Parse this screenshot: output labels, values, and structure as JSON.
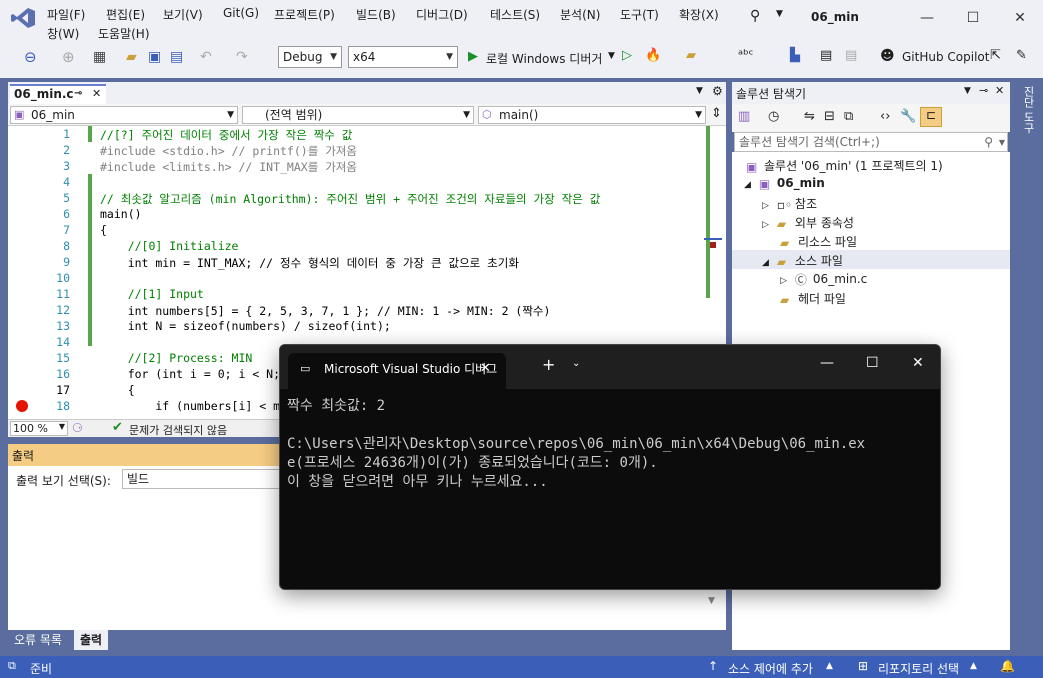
{
  "window": {
    "title": "06_min"
  },
  "menu": [
    "파일(F)",
    "편집(E)",
    "보기(V)",
    "Git(G)",
    "프로젝트(P)",
    "빌드(B)",
    "디버그(D)",
    "테스트(S)",
    "분석(N)",
    "도구(T)",
    "확장(X)",
    "창(W)",
    "도움말(H)"
  ],
  "toolbar": {
    "config": "Debug",
    "platform": "x64",
    "run_label": "로컬 Windows 디버거",
    "copilot": "GitHub Copilot"
  },
  "editor": {
    "tab": "06_min.c",
    "nav_project": "06_min",
    "nav_scope": "(전역 범위)",
    "nav_func": "main()",
    "zoom": "100 %",
    "status": "문제가 검색되지 않음",
    "lines": [
      {
        "n": "1",
        "text": "//[?] 주어진 데이터 중에서 가장 작은 짝수 값"
      },
      {
        "n": "2",
        "text": "#include <stdio.h> // printf()를 가져옴"
      },
      {
        "n": "3",
        "text": "#include <limits.h> // INT_MAX를 가져옴"
      },
      {
        "n": "4",
        "text": ""
      },
      {
        "n": "5",
        "text": "// 최솟값 알고리즘 (min Algorithm): 주어진 범위 + 주어진 조건의 자료들의 가장 작은 값"
      },
      {
        "n": "6",
        "text": "main()"
      },
      {
        "n": "7",
        "text": "{"
      },
      {
        "n": "8",
        "text": "    //[0] Initialize"
      },
      {
        "n": "9",
        "text": "    int min = INT_MAX; // 정수 형식의 데이터 중 가장 큰 값으로 초기화"
      },
      {
        "n": "10",
        "text": ""
      },
      {
        "n": "11",
        "text": "    //[1] Input"
      },
      {
        "n": "12",
        "text": "    int numbers[5] = { 2, 5, 3, 7, 1 }; // MIN: 1 -> MIN: 2 (짝수)"
      },
      {
        "n": "13",
        "text": "    int N = sizeof(numbers) / sizeof(int);"
      },
      {
        "n": "14",
        "text": ""
      },
      {
        "n": "15",
        "text": "    //[2] Process: MIN"
      },
      {
        "n": "16",
        "text": "    for (int i = 0; i < N;"
      },
      {
        "n": "17",
        "text": "    {"
      },
      {
        "n": "18",
        "text": "        if (numbers[i] < m"
      }
    ]
  },
  "output": {
    "title": "출력",
    "select_label": "출력 보기 선택(S):",
    "select_value": "빌드",
    "tabs": [
      "오류 목록",
      "출력"
    ]
  },
  "solution": {
    "title": "솔루션 탐색기",
    "search_placeholder": "솔루션 탐색기 검색(Ctrl+;)",
    "root": "솔루션 '06_min' (1 프로젝트의 1)",
    "project": "06_min",
    "items": [
      "참조",
      "외부 종속성",
      "리소스 파일",
      "소스 파일",
      "06_min.c",
      "헤더 파일"
    ],
    "side_tab": "진단 도구"
  },
  "console": {
    "title": "Microsoft Visual Studio 디버그",
    "lines": [
      "짝수 최솟값: 2",
      "",
      "C:\\Users\\관리자\\Desktop\\source\\repos\\06_min\\06_min\\x64\\Debug\\06_min.ex",
      "e(프로세스 24636개)이(가) 종료되었습니다(코드: 0개).",
      "이 창을 닫으려면 아무 키나 누르세요..."
    ]
  },
  "statusbar": {
    "ready": "준비",
    "source_control": "소스 제어에 추가",
    "repo": "리포지토리 선택"
  },
  "colors": {
    "accent": "#3b5fb8",
    "frame": "#5a6d9e",
    "output_header": "#f5cc84"
  }
}
